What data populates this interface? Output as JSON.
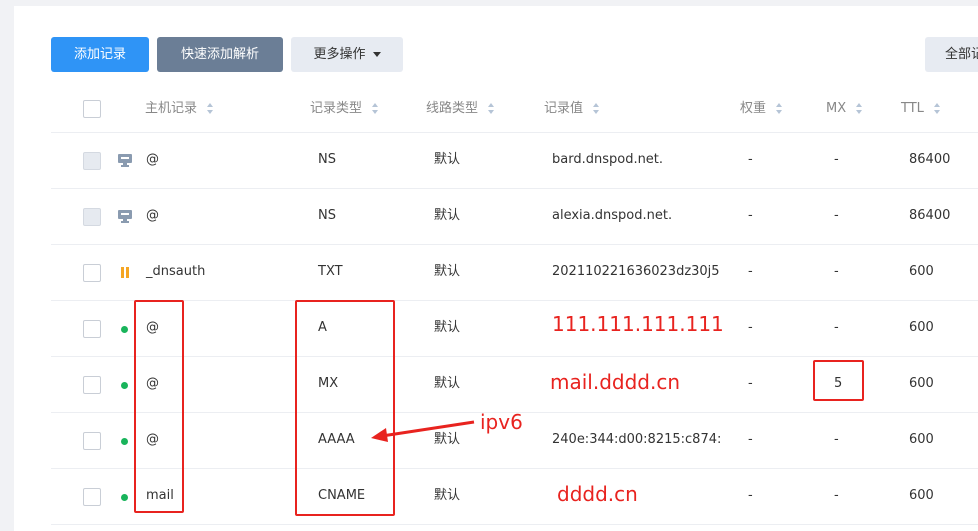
{
  "toolbar": {
    "add_label": "添加记录",
    "quick_add_label": "快速添加解析",
    "more_label": "更多操作",
    "all_label": "全部记"
  },
  "columns": [
    "主机记录",
    "记录类型",
    "线路类型",
    "记录值",
    "权重",
    "MX",
    "TTL"
  ],
  "rows": [
    {
      "host": "@",
      "type": "NS",
      "line": "默认",
      "value": "bard.dnspod.net.",
      "weight": "-",
      "mx": "-",
      "ttl": "86400",
      "status": "system"
    },
    {
      "host": "@",
      "type": "NS",
      "line": "默认",
      "value": "alexia.dnspod.net.",
      "weight": "-",
      "mx": "-",
      "ttl": "86400",
      "status": "system"
    },
    {
      "host": "_dnsauth",
      "type": "TXT",
      "line": "默认",
      "value": "20211022163602​3dz30j5...",
      "weight": "-",
      "mx": "-",
      "ttl": "600",
      "status": "paused"
    },
    {
      "host": "@",
      "type": "A",
      "line": "默认",
      "value": "111.111.111.111",
      "weight": "-",
      "mx": "-",
      "ttl": "600",
      "status": "enabled"
    },
    {
      "host": "@",
      "type": "MX",
      "line": "默认",
      "value": "mail.dddd.cn",
      "weight": "-",
      "mx": "5",
      "ttl": "600",
      "status": "enabled"
    },
    {
      "host": "@",
      "type": "AAAA",
      "line": "默认",
      "value": "240e:344:d00:8215:c874:...",
      "weight": "-",
      "mx": "-",
      "ttl": "600",
      "status": "enabled"
    },
    {
      "host": "mail",
      "type": "CNAME",
      "line": "默认",
      "value": "dddd.cn",
      "weight": "-",
      "mx": "-",
      "ttl": "600",
      "status": "enabled"
    }
  ],
  "annotation": "ipv6",
  "colors": {
    "primary": "#2f94f6",
    "secondary": "#6b7e96",
    "highlight": "#e8231f",
    "enabled": "#19b45b",
    "paused": "#f5a623"
  }
}
